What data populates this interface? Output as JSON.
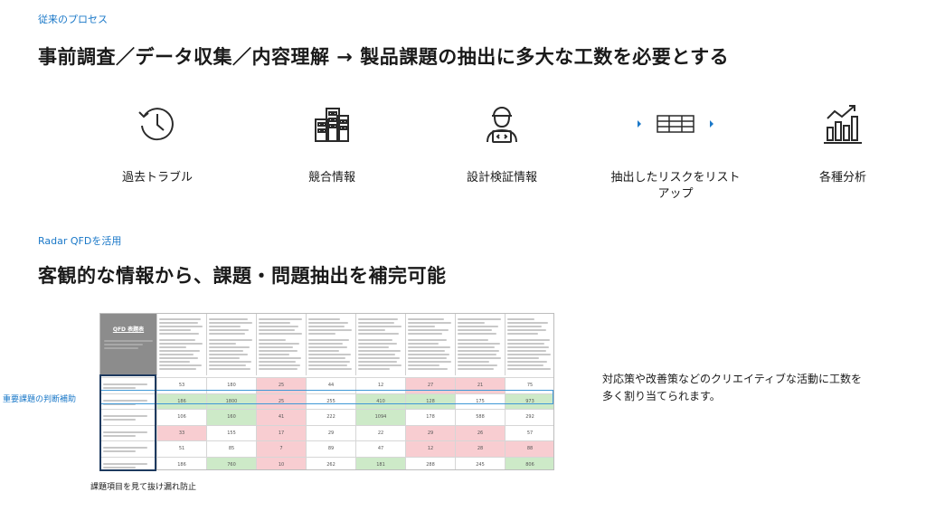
{
  "section1": {
    "label": "従来のプロセス",
    "heading": "事前調査／データ収集／内容理解 → 製品課題の抽出に多大な工数を必要とする",
    "items": [
      {
        "icon": "clock-history-icon",
        "caption": "過去トラブル"
      },
      {
        "icon": "buildings-icon",
        "caption": "競合情報"
      },
      {
        "icon": "engineer-laptop-icon",
        "caption": "設計検証情報"
      },
      {
        "icon": "list-table-icon",
        "caption": "抽出したリスクをリスト\nアップ"
      },
      {
        "icon": "bar-chart-icon",
        "caption": "各種分析"
      }
    ]
  },
  "section2": {
    "label": "Radar QFDを活用",
    "heading": "客観的な情報から、課題・問題抽出を補完可能",
    "qfd_title": "QFD 表題表",
    "row_highlight_label": "重要課題の判断補助",
    "bottom_note": "課題項目を見て抜け漏れ防止",
    "side_text": "対応策や改善策などのクリエイティブな活動に工数を\n多く割り当てられます。"
  },
  "colors": {
    "accent": "#1a78c8",
    "cell_red": "#f8cdd1",
    "cell_green": "#cdeac8",
    "highlight_border": "#3f98d6"
  },
  "qfd_table": {
    "rows": [
      [
        "53",
        "180",
        "25",
        "44",
        "12",
        "27",
        "21",
        "75"
      ],
      [
        "186",
        "1800",
        "25",
        "255",
        "410",
        "128",
        "175",
        "973"
      ],
      [
        "106",
        "160",
        "41",
        "222",
        "1094",
        "178",
        "588",
        "292"
      ],
      [
        "33",
        "155",
        "17",
        "29",
        "22",
        "29",
        "26",
        "57"
      ],
      [
        "51",
        "85",
        "7",
        "89",
        "47",
        "12",
        "28",
        "88"
      ],
      [
        "186",
        "760",
        "10",
        "262",
        "181",
        "288",
        "245",
        "806"
      ]
    ],
    "shading": [
      [
        "n",
        "n",
        "r",
        "n",
        "n",
        "r",
        "r",
        "n"
      ],
      [
        "g",
        "g",
        "r",
        "n",
        "g",
        "g",
        "n",
        "g"
      ],
      [
        "n",
        "g",
        "r",
        "n",
        "g",
        "n",
        "n",
        "n"
      ],
      [
        "r",
        "n",
        "r",
        "n",
        "n",
        "r",
        "r",
        "n"
      ],
      [
        "n",
        "n",
        "r",
        "n",
        "n",
        "r",
        "r",
        "r"
      ],
      [
        "n",
        "g",
        "r",
        "n",
        "g",
        "n",
        "n",
        "g"
      ]
    ]
  }
}
